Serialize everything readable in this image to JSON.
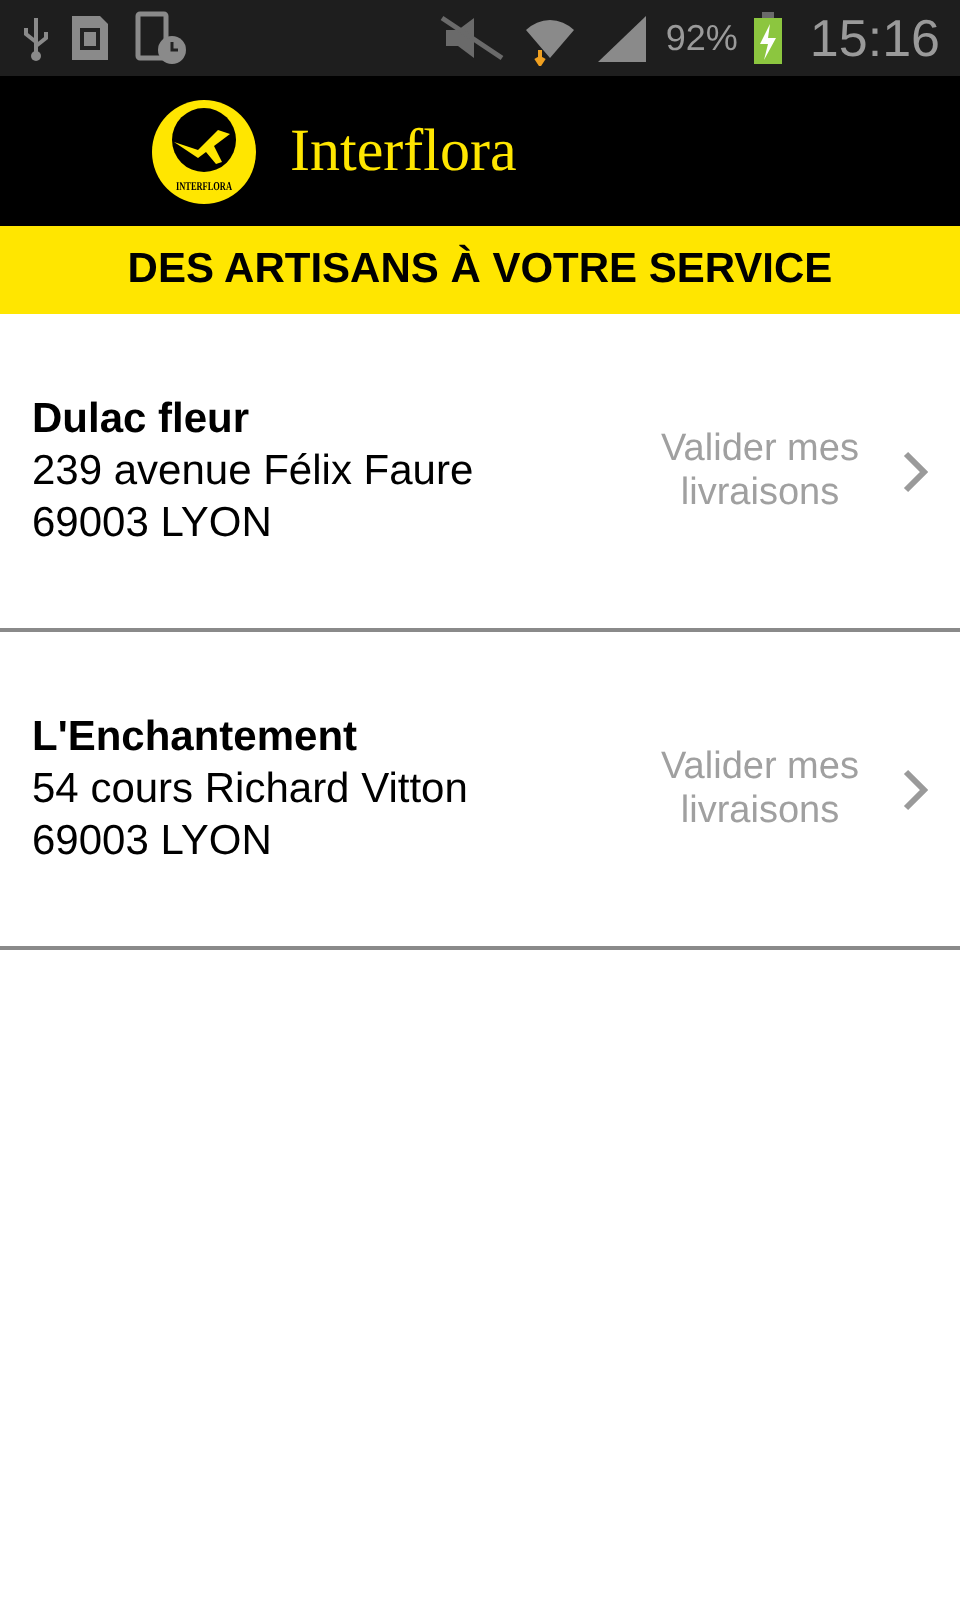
{
  "status_bar": {
    "battery": "92%",
    "time": "15:16"
  },
  "header": {
    "logo_text": "INTERFLORA",
    "title": "Interflora"
  },
  "banner": "DES ARTISANS À VOTRE SERVICE",
  "shops": [
    {
      "name": "Dulac fleur",
      "address": "239 avenue Félix Faure",
      "city": "69003 LYON",
      "action": "Valider mes livraisons"
    },
    {
      "name": "L'Enchantement",
      "address": "54 cours Richard Vitton",
      "city": "69003 LYON",
      "action": "Valider mes livraisons"
    }
  ]
}
